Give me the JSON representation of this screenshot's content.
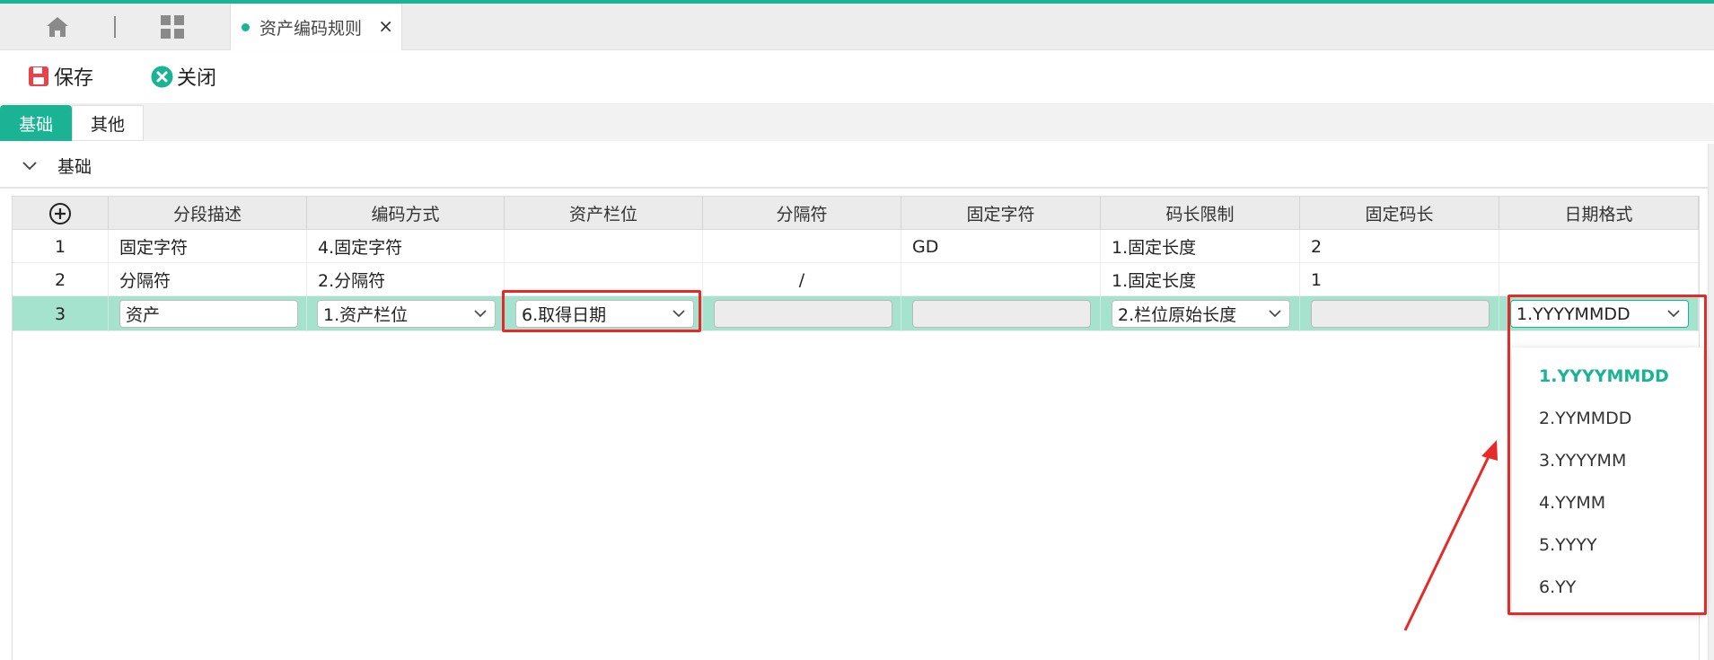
{
  "tabbar": {
    "home_icon": "home-icon",
    "apps_icon": "grid-icon",
    "active_tab": {
      "label": "资产编码规则",
      "close": "×",
      "dot_color": "#1ab394"
    }
  },
  "toolbar": {
    "save_label": "保存",
    "close_label": "关闭"
  },
  "subtabs": [
    {
      "label": "基础",
      "active": true
    },
    {
      "label": "其他",
      "active": false
    }
  ],
  "section": {
    "title": "基础",
    "expanded": true
  },
  "table": {
    "add_icon": "plus-circle-icon",
    "columns": [
      "分段描述",
      "编码方式",
      "资产栏位",
      "分隔符",
      "固定字符",
      "码长限制",
      "固定码长",
      "日期格式"
    ],
    "rows": [
      {
        "no": "1",
        "desc": "固定字符",
        "method": "4.固定字符",
        "field": "",
        "sep": "",
        "fixed": "GD",
        "limit": "1.固定长度",
        "len": "2",
        "date": ""
      },
      {
        "no": "2",
        "desc": "分隔符",
        "method": "2.分隔符",
        "field": "",
        "sep": "/",
        "fixed": "",
        "limit": "1.固定长度",
        "len": "1",
        "date": ""
      }
    ],
    "edit_row": {
      "no": "3",
      "desc": "资产",
      "method": "1.资产栏位",
      "field": "6.取得日期",
      "sep": "",
      "fixed": "",
      "limit": "2.栏位原始长度",
      "len": "",
      "date": "1.YYYYMMDD"
    }
  },
  "date_dropdown": {
    "options": [
      "1.YYYYMMDD",
      "2.YYMMDD",
      "3.YYYYMM",
      "4.YYMM",
      "5.YYYY",
      "6.YY"
    ],
    "selected": "1.YYYYMMDD"
  },
  "colors": {
    "accent": "#1ab394",
    "selected_row": "#a5e3cf",
    "annotation_red": "#e62a2a",
    "save_icon": "#e8424a"
  }
}
